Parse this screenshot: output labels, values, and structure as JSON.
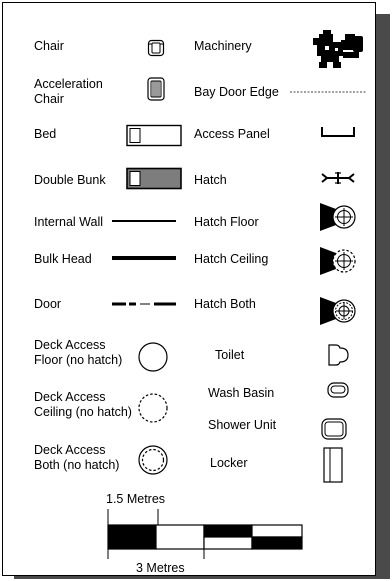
{
  "legend": {
    "left": [
      {
        "label": "Chair",
        "symbol": "chair-icon"
      },
      {
        "label": "Acceleration\nChair",
        "symbol": "acceleration-chair-icon"
      },
      {
        "label": "Bed",
        "symbol": "bed-icon"
      },
      {
        "label": "Double Bunk",
        "symbol": "double-bunk-icon"
      },
      {
        "label": "Internal Wall",
        "symbol": "internal-wall-line"
      },
      {
        "label": "Bulk Head",
        "symbol": "bulk-head-line"
      },
      {
        "label": "Door",
        "symbol": "door-line"
      },
      {
        "label": "Deck Access\nFloor (no hatch)",
        "symbol": "deck-access-floor-icon"
      },
      {
        "label": "Deck Access\nCeiling (no hatch)",
        "symbol": "deck-access-ceiling-icon"
      },
      {
        "label": "Deck Access\nBoth (no hatch)",
        "symbol": "deck-access-both-icon"
      }
    ],
    "right": [
      {
        "label": "Machinery",
        "symbol": "machinery-icon"
      },
      {
        "label": "Bay Door Edge",
        "symbol": "bay-door-edge-line"
      },
      {
        "label": "Access Panel",
        "symbol": "access-panel-icon"
      },
      {
        "label": "Hatch",
        "symbol": "hatch-icon"
      },
      {
        "label": "Hatch Floor",
        "symbol": "hatch-floor-icon"
      },
      {
        "label": "Hatch Ceiling",
        "symbol": "hatch-ceiling-icon"
      },
      {
        "label": "Hatch Both",
        "symbol": "hatch-both-icon"
      },
      {
        "label": "Toilet",
        "symbol": "toilet-icon"
      },
      {
        "label": "Wash Basin",
        "symbol": "wash-basin-icon"
      },
      {
        "label": "Shower Unit",
        "symbol": "shower-unit-icon"
      },
      {
        "label": "Locker",
        "symbol": "locker-icon"
      }
    ]
  },
  "scale": {
    "top_label": "1.5 Metres",
    "bottom_label": "3 Metres"
  }
}
